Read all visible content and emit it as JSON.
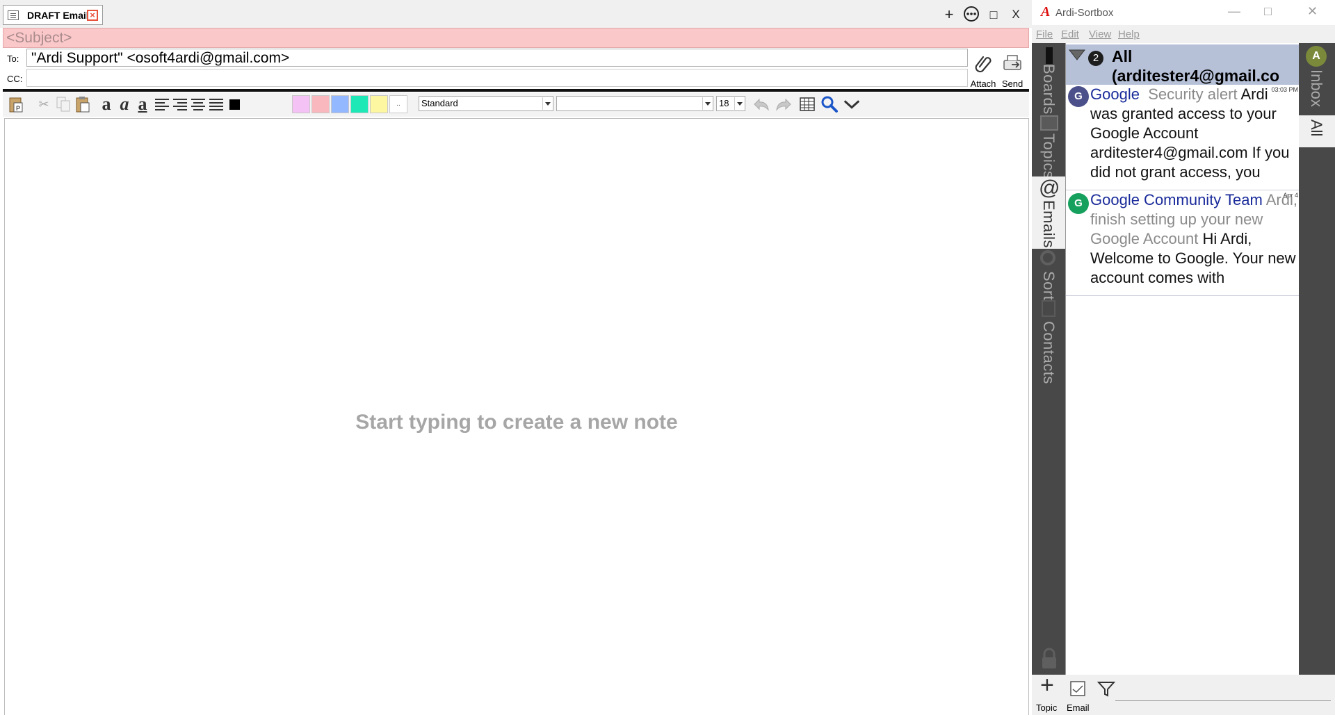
{
  "draft": {
    "tab_title": "DRAFT Email",
    "window_controls": {
      "add": "+",
      "more": "⋯",
      "maximize": "□",
      "close": "X"
    },
    "subject_placeholder": "<Subject>",
    "to_label": "To:",
    "to_value": "\"Ardi Support\" <osoft4ardi@gmail.com>",
    "cc_label": "CC:",
    "cc_value": "",
    "attach_label": "Attach",
    "send_label": "Send",
    "toolbar": {
      "swatches": [
        "#f4c2f4",
        "#f9b8bd",
        "#93b8ff",
        "#1ee8b6",
        "#fdf7a2",
        "#ffffff"
      ],
      "text_color": "#000000",
      "style_value": "Standard",
      "font_value": "",
      "size_value": "18",
      "more_swatch_label": ".."
    },
    "editor_placeholder": "Start typing to create a new note"
  },
  "sortbox": {
    "logo": "A",
    "title": "Ardi-Sortbox",
    "menu": [
      "File",
      "Edit",
      "View",
      "Help"
    ],
    "left_tabs": [
      "Boards",
      "Topics",
      "Emails",
      "Sort",
      "Contacts"
    ],
    "active_tab": "Emails",
    "list_header": {
      "count": "2",
      "title_line1": "All",
      "title_line2": "(arditester4@gmail.co"
    },
    "messages": [
      {
        "avatar": "G",
        "avatar_color": "#4b4f8a",
        "from": "Google",
        "subject": "Security alert",
        "preview": "Ardi was granted access to your Google Account arditester4@gmail.com If you did not grant access, you",
        "date": "03:03 PM"
      },
      {
        "avatar": "G",
        "avatar_color": "#16a05d",
        "from": "Google Community Team",
        "subject": "Ardi, finish setting up your new Google Account",
        "preview": "Hi Ardi, Welcome to Google. Your new account comes with",
        "date": "Apr 4"
      }
    ],
    "right_badge": "A",
    "right_tabs": [
      "Inbox",
      "All"
    ],
    "bottom": {
      "topic_label": "Topic",
      "email_label": "Email",
      "filter_value": ""
    }
  }
}
